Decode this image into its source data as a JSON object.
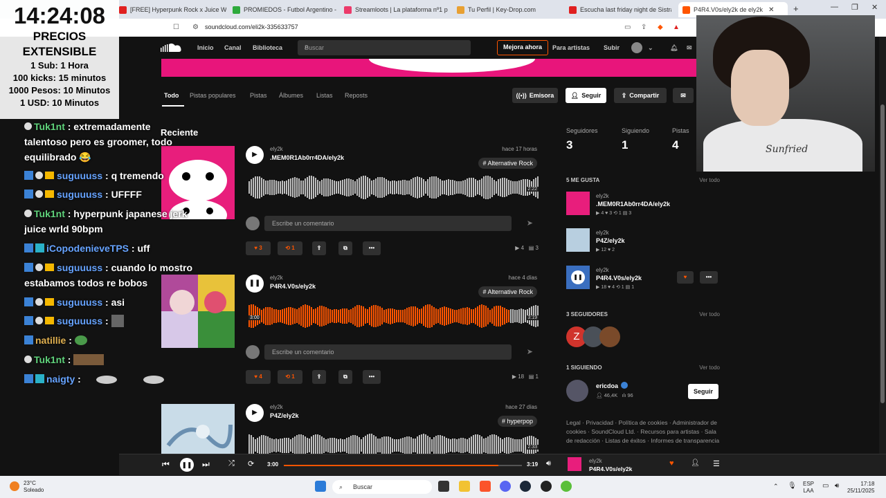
{
  "browser": {
    "tabs": [
      {
        "label": "[FREE] Hyperpunk Rock x Juice WR…",
        "color": "#e02020"
      },
      {
        "label": "PROMIEDOS - Futbol Argentino - Fi…",
        "color": "#2eaa3c"
      },
      {
        "label": "Streamloots | La plataforma nº1 para…",
        "color": "#ec3a6a"
      },
      {
        "label": "Tu Perfil | Key-Drop.com",
        "color": "#e8a032"
      },
      {
        "label": "Escucha last friday night de Sistrack…",
        "color": "#e02020"
      },
      {
        "label": "P4R4.V0s/ely2k de ely2k",
        "color": "#ff5500"
      }
    ],
    "url": "soundcloud.com/eli2k-335633757"
  },
  "header": {
    "nav": [
      "Inicio",
      "Canal",
      "Biblioteca"
    ],
    "search_placeholder": "Buscar",
    "upgrade": "Mejora ahora",
    "for_artists": "Para artistas",
    "upload": "Subir"
  },
  "profile_tabs": [
    "Todo",
    "Pistas populares",
    "Pistas",
    "Álbumes",
    "Listas",
    "Reposts"
  ],
  "actions": {
    "station": "Emisora",
    "follow": "Seguir",
    "share": "Compartir"
  },
  "recent_title": "Reciente",
  "comment_placeholder": "Escribe un comentario",
  "tracks": [
    {
      "user": "ely2k",
      "title": ".MEM0R1Ab0rr4DA/ely2k",
      "time": "hace 17 horas",
      "tag": "# Alternative Rock",
      "duration": "2:22",
      "likes": "3",
      "reposts": "1",
      "plays": "4",
      "comments": "3",
      "progress": 0
    },
    {
      "user": "ely2k",
      "title": "P4R4.V0s/ely2k",
      "time": "hace 4 días",
      "tag": "# Alternative Rock",
      "duration": "3:19",
      "elapsed": "3:00",
      "likes": "4",
      "reposts": "1",
      "plays": "18",
      "comments": "1",
      "progress": 0.9
    },
    {
      "user": "ely2k",
      "title": "P4Z/ely2k",
      "time": "hace 27 días",
      "tag": "# hyperpop",
      "duration": "2:33"
    }
  ],
  "sidebar": {
    "stats": [
      {
        "label": "Seguidores",
        "value": "3"
      },
      {
        "label": "Siguiendo",
        "value": "1"
      },
      {
        "label": "Pistas",
        "value": "4"
      }
    ],
    "likes_header": "5 ME GUSTA",
    "view_all": "Ver todo",
    "liked": [
      {
        "user": "ely2k",
        "title": ".MEM0R1Ab0rr4DA/ely2k",
        "stats": "▶ 4   ♥ 3   ⟲ 1   ▤ 3"
      },
      {
        "user": "ely2k",
        "title": "P4Z/ely2k",
        "stats": "▶ 12   ♥ 2"
      },
      {
        "user": "ely2k",
        "title": "P4R4.V0s/ely2k",
        "stats": "▶ 18   ♥ 4   ⟲ 1   ▤ 1"
      }
    ],
    "followers_header": "3 SEGUIDORES",
    "following_header": "1 SIGUIENDO",
    "following_user": {
      "name": "ericdoa",
      "followers": "46,4K",
      "tracks": "96",
      "follow": "Seguir"
    },
    "footer": "Legal · Privacidad · Política de cookies · Administrador de cookies · SoundCloud Ltd. · Recursos para artistas · Sala de redacción · Listas de éxitos · Informes de transparencia"
  },
  "player": {
    "elapsed": "3:00",
    "duration": "3:19",
    "progress": 0.9,
    "user": "ely2k",
    "title": "P4R4.V0s/ely2k"
  },
  "overlay": {
    "timer": "14:24:08",
    "prices_title": "PRECIOS EXTENSIBLE",
    "prices": [
      "1 Sub: 1 Hora",
      "100 kicks: 15 minutos",
      "1000 Pesos: 10 Minutos",
      "1 USD: 10 Minutos"
    ],
    "shirt_text": "Sunfried"
  },
  "chat": [
    {
      "user": "Tuk1nt",
      "msg": ": extremadamente",
      "color": "#60d47c"
    },
    {
      "user": "",
      "msg": "talentoso pero es groomer, todo",
      "color": "#fff"
    },
    {
      "user": "",
      "msg": "equilibrado 😂",
      "color": "#fff"
    },
    {
      "user": "suguuuss",
      "msg": ": q tremendo",
      "color": "#66a3ff"
    },
    {
      "user": "suguuuss",
      "msg": ": UFFFF",
      "color": "#66a3ff"
    },
    {
      "user": "Tuk1nt",
      "msg": ": hyperpunk japanese jerk",
      "color": "#60d47c"
    },
    {
      "user": "",
      "msg": "juice wrld 90bpm",
      "color": "#fff"
    },
    {
      "user": "iCopodenieveTPS",
      "msg": ": uff",
      "color": "#66a3ff"
    },
    {
      "user": "suguuuss",
      "msg": ": cuando lo mostro",
      "color": "#66a3ff"
    },
    {
      "user": "",
      "msg": "estabamos todos re bobos",
      "color": "#fff"
    },
    {
      "user": "suguuuss",
      "msg": ": asi",
      "color": "#66a3ff"
    },
    {
      "user": "suguuuss",
      "msg": ":",
      "color": "#66a3ff"
    },
    {
      "user": "natillie",
      "msg": ":",
      "color": "#e0b050"
    },
    {
      "user": "Tuk1nt",
      "msg": ":",
      "color": "#60d47c"
    },
    {
      "user": "naigty",
      "msg": ":",
      "color": "#66a3ff"
    }
  ],
  "taskbar": {
    "temp": "23°C",
    "weather": "Soleado",
    "search": "Buscar",
    "lang": "ESP",
    "region": "LAA",
    "time": "17:18",
    "date": "25/11/2025"
  },
  "colors": {
    "accent": "#ff5500",
    "bg": "#121212"
  }
}
